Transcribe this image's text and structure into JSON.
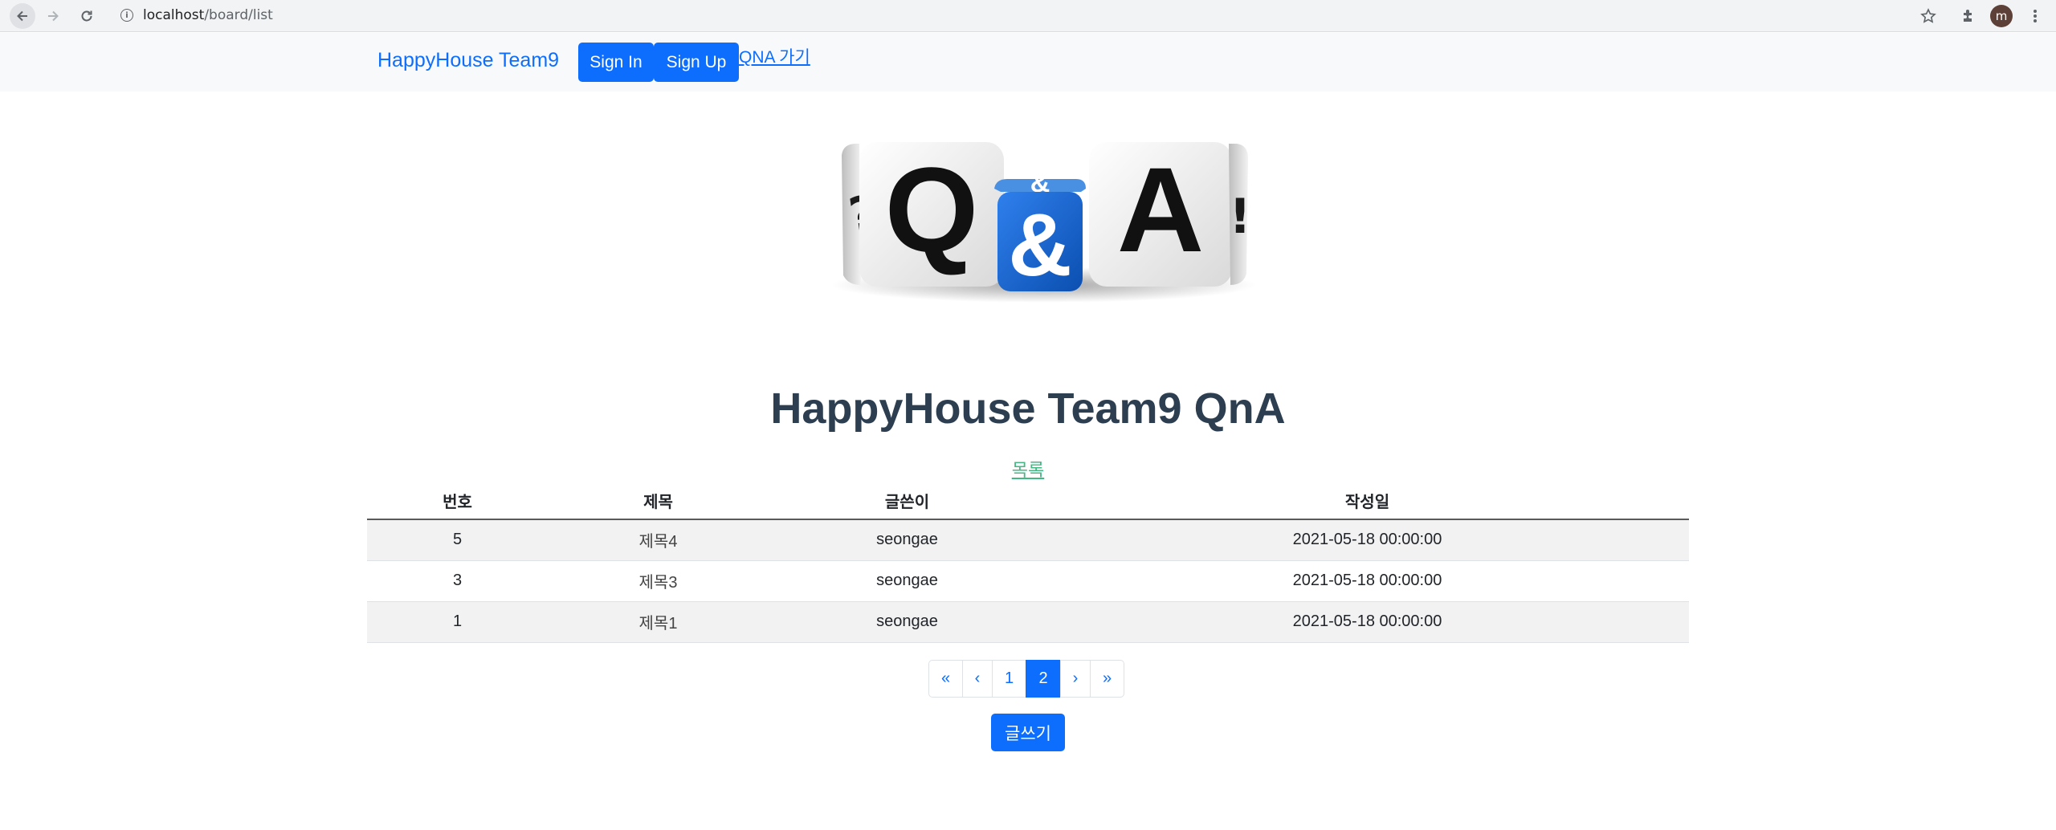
{
  "browser": {
    "url_host": "localhost",
    "url_path": "/board/list",
    "avatar_letter": "m"
  },
  "navbar": {
    "brand": "HappyHouse Team9",
    "signin_label": "Sign In",
    "signup_label": "Sign Up",
    "qna_link": "QNA 가기"
  },
  "hero": {
    "image_alt": "Q&A dice",
    "letters": [
      "Q",
      "&",
      "A"
    ],
    "accent_color": "#1565d8"
  },
  "main": {
    "title": "HappyHouse Team9 QnA",
    "list_link": "목록"
  },
  "table": {
    "headers": [
      "번호",
      "제목",
      "글쓴이",
      "작성일"
    ],
    "rows": [
      {
        "no": "5",
        "title": "제목4",
        "writer": "seongae",
        "date": "2021-05-18 00:00:00"
      },
      {
        "no": "3",
        "title": "제목3",
        "writer": "seongae",
        "date": "2021-05-18 00:00:00"
      },
      {
        "no": "1",
        "title": "제목1",
        "writer": "seongae",
        "date": "2021-05-18 00:00:00"
      }
    ]
  },
  "pagination": {
    "first": "«",
    "prev": "‹",
    "pages": [
      "1",
      "2"
    ],
    "active_page": "2",
    "next": "›",
    "last": "»"
  },
  "write_button": "글쓰기",
  "colors": {
    "primary": "#0d6efd",
    "title": "#2c3e50",
    "link_green": "#42b983"
  }
}
